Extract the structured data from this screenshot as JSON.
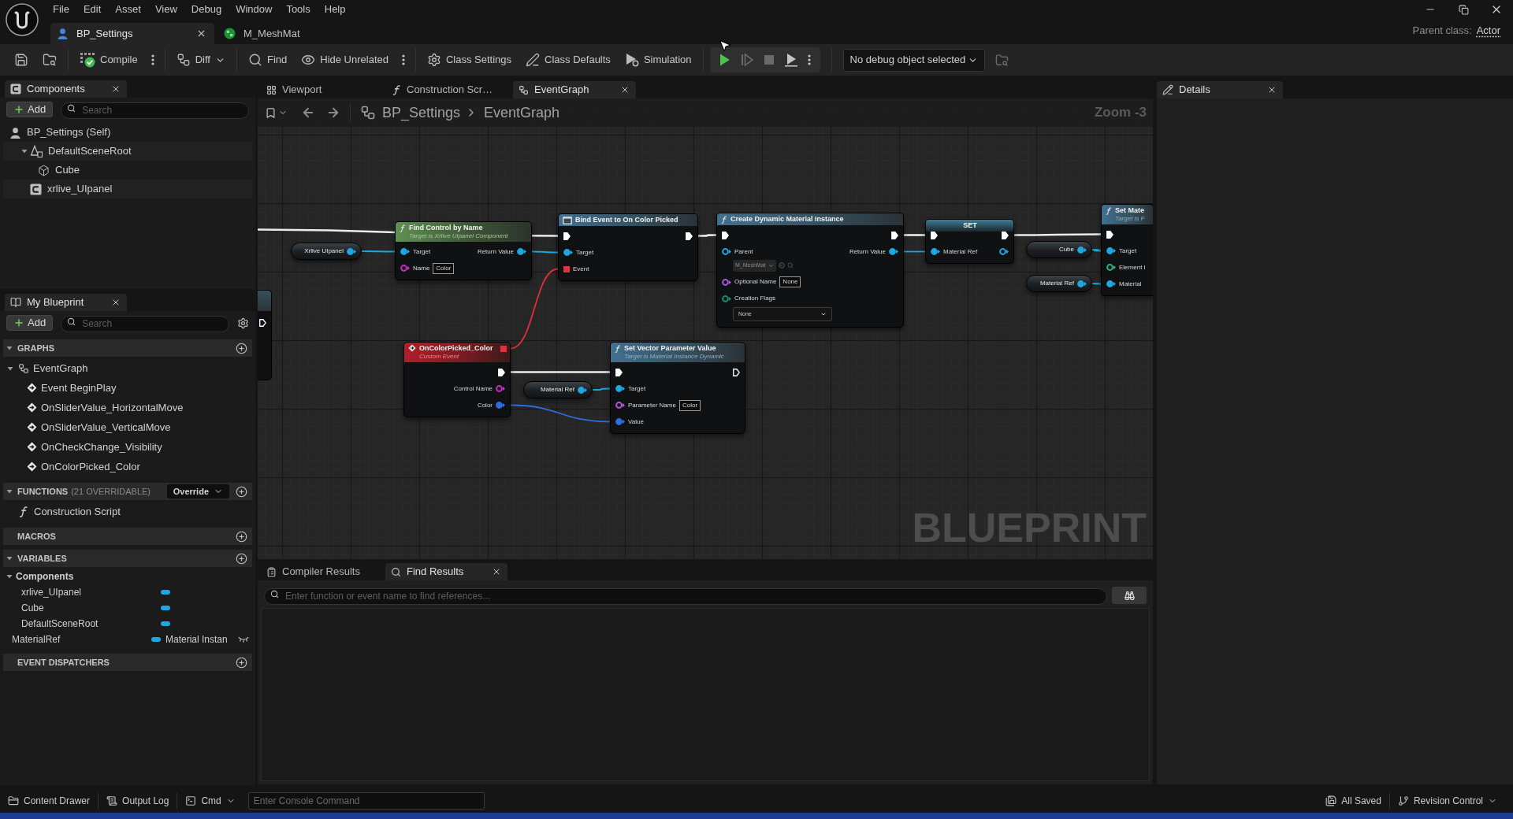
{
  "window": {
    "menu": [
      "File",
      "Edit",
      "Asset",
      "View",
      "Debug",
      "Window",
      "Tools",
      "Help"
    ]
  },
  "document_tabs": [
    {
      "label": "BP_Settings",
      "kind": "blueprint",
      "selected": true
    },
    {
      "label": "M_MeshMat",
      "kind": "material",
      "selected": false
    }
  ],
  "parent_class": {
    "label": "Parent class:",
    "value": "Actor"
  },
  "toolbar": {
    "groups": [
      {
        "items": [
          {
            "kind": "save"
          },
          {
            "kind": "browse"
          }
        ]
      },
      {
        "items": [
          {
            "kind": "compile",
            "label": "Compile",
            "options": true
          }
        ]
      },
      {
        "items": [
          {
            "kind": "diff",
            "label": "Diff",
            "dropdown": true
          }
        ]
      },
      {
        "items": [
          {
            "kind": "find",
            "label": "Find"
          },
          {
            "kind": "hide_unrelated",
            "label": "Hide Unrelated",
            "options": true
          }
        ]
      },
      {
        "items": [
          {
            "kind": "class_settings",
            "label": "Class Settings"
          },
          {
            "kind": "class_defaults",
            "label": "Class Defaults"
          },
          {
            "kind": "simulation",
            "label": "Simulation"
          }
        ]
      }
    ],
    "play_controls": [
      {
        "kind": "play",
        "disabled": false
      },
      {
        "kind": "step",
        "disabled": true
      },
      {
        "kind": "stop",
        "disabled": true
      },
      {
        "kind": "launch",
        "disabled": false
      }
    ],
    "debug_object": "No debug object selected"
  },
  "components_panel": {
    "title": "Components",
    "add_label": "Add",
    "search_placeholder": "Search",
    "self": {
      "label": "BP_Settings (Self)"
    },
    "tree": [
      {
        "label": "DefaultSceneRoot",
        "kind": "scene_root",
        "expanded": true,
        "children": [
          {
            "label": "Cube",
            "kind": "mesh"
          }
        ]
      },
      {
        "label": "xrlive_UIpanel",
        "kind": "component"
      }
    ]
  },
  "my_blueprint": {
    "title": "My Blueprint",
    "add_label": "Add",
    "search_placeholder": "Search",
    "sections": [
      {
        "title": "GRAPHS",
        "expanded": true,
        "items": [
          {
            "kind": "graph",
            "label": "EventGraph",
            "expanded": true,
            "children": [
              {
                "kind": "event",
                "label": "Event BeginPlay"
              },
              {
                "kind": "event",
                "label": "OnSliderValue_HorizontalMove"
              },
              {
                "kind": "event",
                "label": "OnSliderValue_VerticalMove"
              },
              {
                "kind": "event",
                "label": "OnCheckChange_Visibility"
              },
              {
                "kind": "event",
                "label": "OnColorPicked_Color"
              }
            ]
          }
        ]
      },
      {
        "title": "FUNCTIONS",
        "note": "(21 OVERRIDABLE)",
        "dropdown": "Override",
        "expanded": true,
        "items": [
          {
            "kind": "function",
            "label": "Construction Script"
          }
        ]
      },
      {
        "title": "MACROS"
      },
      {
        "title": "VARIABLES",
        "expanded": true,
        "items": [
          {
            "kind": "category",
            "label": "Components",
            "expanded": true,
            "children": [
              {
                "kind": "variable",
                "label": "xrlive_UIpanel"
              },
              {
                "kind": "variable",
                "label": "Cube"
              },
              {
                "kind": "variable",
                "label": "DefaultSceneRoot"
              }
            ]
          },
          {
            "kind": "variable",
            "label": "MaterialRef",
            "type_label": "Material Instan",
            "instance_editable": false
          }
        ]
      },
      {
        "title": "EVENT DISPATCHERS"
      }
    ]
  },
  "editor_tabs": [
    {
      "label": "Viewport",
      "kind": "viewport",
      "selected": false
    },
    {
      "label": "Construction Scr…",
      "kind": "function",
      "selected": false
    },
    {
      "label": "EventGraph",
      "kind": "graph",
      "selected": true
    }
  ],
  "graph": {
    "breadcrumb": [
      "BP_Settings",
      "EventGraph"
    ],
    "zoom_label": "Zoom -3",
    "type_label": "BLUEPRINT",
    "nodes": [
      {
        "kind": "variable_get",
        "title": "Xrlive UIpanel",
        "rows": [
          {
            "out": {
              "kind": "data",
              "color": "#1ea7e1",
              "connected": true
            }
          }
        ]
      },
      {
        "kind": "pure_function",
        "title": "Find Control by Name",
        "subtitle": "Target is Xrlive Uipanel Component",
        "rows": [
          {
            "in": {
              "label": "Target",
              "kind": "data",
              "color": "#1ea7e1",
              "connected": true
            },
            "out": {
              "label": "Return Value",
              "kind": "data",
              "color": "#1ea7e1",
              "connected": true
            }
          },
          {
            "in": {
              "label": "Name",
              "kind": "data",
              "color": "#c72dc7",
              "connected": false,
              "field": {
                "kind": "text",
                "value": "Color"
              }
            }
          }
        ]
      },
      {
        "kind": "bind_event",
        "title": "Bind Event to On Color Picked",
        "rows": [
          {
            "in": {
              "kind": "exec",
              "connected": true
            },
            "out": {
              "kind": "exec",
              "connected": true
            }
          },
          {
            "in": {
              "label": "Target",
              "kind": "data",
              "color": "#1ea7e1",
              "connected": true
            }
          },
          {
            "in": {
              "label": "Event",
              "kind": "delegate",
              "color": "#e2303c",
              "connected": true
            }
          }
        ]
      },
      {
        "kind": "function",
        "title": "Create Dynamic Material Instance",
        "rows": [
          {
            "in": {
              "kind": "exec",
              "connected": true
            },
            "out": {
              "kind": "exec",
              "connected": true
            }
          },
          {
            "in": {
              "label": "Parent",
              "kind": "data",
              "color": "#1ea7e1",
              "connected": false,
              "field": {
                "kind": "asset",
                "value": "M_MeshMat"
              }
            },
            "out": {
              "label": "Return Value",
              "kind": "data",
              "color": "#1ea7e1",
              "connected": true
            }
          },
          {
            "in": {
              "label": "Optional Name",
              "kind": "data",
              "color": "#a45ad8",
              "connected": false,
              "field": {
                "kind": "text",
                "value": "None"
              }
            }
          },
          {
            "in": {
              "label": "Creation Flags",
              "kind": "data",
              "color": "#1f8a72",
              "connected": false,
              "field": {
                "kind": "dropdown",
                "value": "None"
              }
            }
          }
        ]
      },
      {
        "kind": "variable_set",
        "title": "SET",
        "rows": [
          {
            "in": {
              "kind": "exec",
              "connected": true
            },
            "out": {
              "kind": "exec",
              "connected": true
            }
          },
          {
            "in": {
              "label": "Material Ref",
              "kind": "data",
              "color": "#1ea7e1",
              "connected": true
            },
            "out": {
              "kind": "data",
              "color": "#1ea7e1",
              "connected": false
            }
          }
        ]
      },
      {
        "kind": "variable_get",
        "title": "Cube",
        "rows": [
          {
            "out": {
              "kind": "data",
              "color": "#1ea7e1",
              "connected": true
            }
          }
        ]
      },
      {
        "kind": "variable_get",
        "title": "Material Ref",
        "rows": [
          {
            "out": {
              "kind": "data",
              "color": "#1ea7e1",
              "connected": true
            }
          }
        ]
      },
      {
        "kind": "function",
        "title": "Set Mate",
        "subtitle": "Target is F",
        "rows": [
          {
            "in": {
              "kind": "exec",
              "connected": true
            }
          },
          {
            "in": {
              "label": "Target",
              "kind": "data",
              "color": "#1ea7e1",
              "connected": true
            }
          },
          {
            "in": {
              "label": "Element I",
              "kind": "data",
              "color": "#2fb37a",
              "connected": false
            }
          },
          {
            "in": {
              "label": "Material",
              "kind": "data",
              "color": "#1ea7e1",
              "connected": true
            }
          }
        ]
      },
      {
        "kind": "custom_event",
        "title": "OnColorPicked_Color",
        "subtitle": "Custom Event",
        "header_pin": {
          "kind": "delegate",
          "color": "#e2303c",
          "connected": true
        },
        "rows": [
          {
            "out": {
              "kind": "exec",
              "connected": true
            }
          },
          {
            "out": {
              "label": "Control Name",
              "kind": "data",
              "color": "#c72dc7",
              "connected": false
            }
          },
          {
            "out": {
              "label": "Color",
              "kind": "data",
              "color": "#2e6ee0",
              "connected": true
            }
          }
        ]
      },
      {
        "kind": "variable_get",
        "title": "Material Ref",
        "rows": [
          {
            "out": {
              "kind": "data",
              "color": "#1ea7e1",
              "connected": true
            }
          }
        ]
      },
      {
        "kind": "function",
        "title": "Set Vector Parameter Value",
        "subtitle": "Target is Material Instance Dynamic",
        "rows": [
          {
            "in": {
              "kind": "exec",
              "connected": true
            },
            "out": {
              "kind": "exec",
              "connected": false
            }
          },
          {
            "in": {
              "label": "Target",
              "kind": "data",
              "color": "#1ea7e1",
              "connected": true
            }
          },
          {
            "in": {
              "label": "Parameter Name",
              "kind": "data",
              "color": "#b15ad6",
              "connected": false,
              "field": {
                "kind": "text",
                "value": "Color"
              }
            }
          },
          {
            "in": {
              "label": "Value",
              "kind": "data",
              "color": "#2e6ee0",
              "connected": true
            }
          }
        ]
      }
    ]
  },
  "find_panel": {
    "tabs": [
      {
        "label": "Compiler Results",
        "kind": "compiler_results",
        "selected": false
      },
      {
        "label": "Find Results",
        "kind": "find_results",
        "selected": true
      }
    ],
    "search_placeholder": "Enter function or event name to find references..."
  },
  "details_panel": {
    "title": "Details"
  },
  "status_bar": {
    "left": [
      {
        "label": "Content Drawer",
        "kind": "content_drawer"
      },
      {
        "label": "Output Log",
        "kind": "output_log"
      },
      {
        "label": "Cmd",
        "kind": "cmd",
        "dropdown": true
      }
    ],
    "console_placeholder": "Enter Console Command",
    "right": [
      {
        "label": "All Saved",
        "kind": "saved"
      },
      {
        "label": "Revision Control",
        "kind": "revision_control",
        "dropdown": true
      }
    ]
  }
}
